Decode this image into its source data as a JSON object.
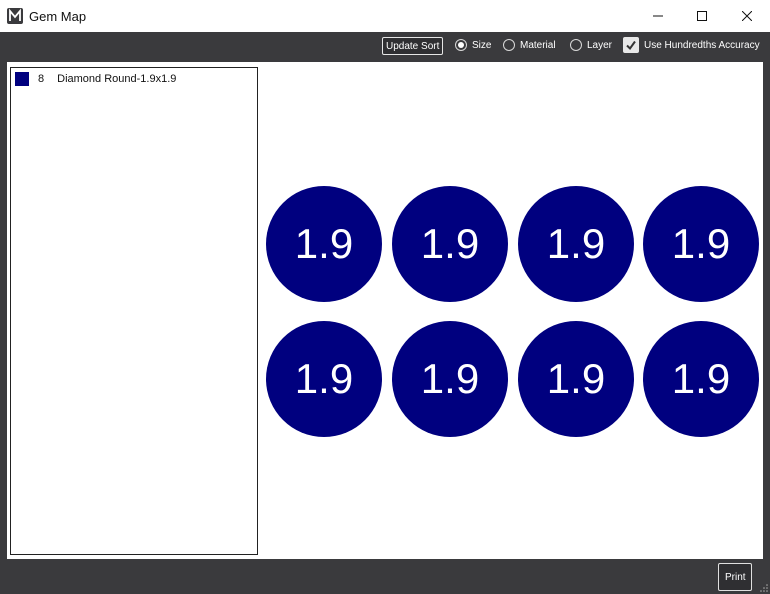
{
  "window": {
    "title": "Gem Map",
    "icons": {
      "app": "app-logo-icon",
      "minimize": "minimize-icon",
      "maximize": "maximize-icon",
      "close": "close-icon"
    }
  },
  "toolbar": {
    "update_sort_label": "Update Sort",
    "sort_options": [
      {
        "label": "Size",
        "checked": true
      },
      {
        "label": "Material",
        "checked": false
      },
      {
        "label": "Layer",
        "checked": false
      }
    ],
    "hundredths": {
      "label": "Use Hundredths Accuracy",
      "checked": true
    }
  },
  "legend": {
    "items": [
      {
        "count": "8",
        "label": "Diamond Round-1.9x1.9",
        "color": "#00007f"
      }
    ]
  },
  "gems": {
    "color": "#00007f",
    "labels": [
      "1.9",
      "1.9",
      "1.9",
      "1.9",
      "1.9",
      "1.9",
      "1.9",
      "1.9"
    ]
  },
  "footer": {
    "print_label": "Print"
  }
}
